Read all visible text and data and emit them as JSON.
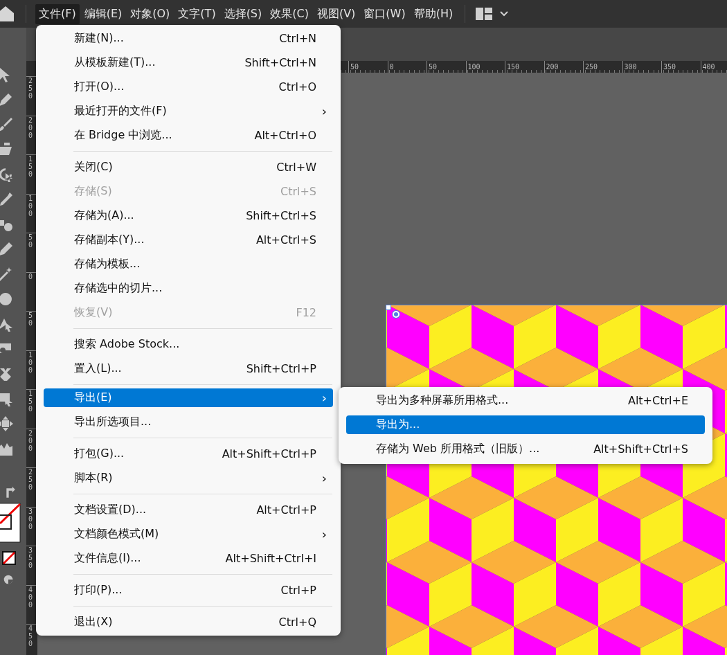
{
  "menu_bar": {
    "items": [
      {
        "label": "文件(F)",
        "selected": true
      },
      {
        "label": "编辑(E)",
        "selected": false
      },
      {
        "label": "对象(O)",
        "selected": false
      },
      {
        "label": "文字(T)",
        "selected": false
      },
      {
        "label": "选择(S)",
        "selected": false
      },
      {
        "label": "效果(C)",
        "selected": false
      },
      {
        "label": "视图(V)",
        "selected": false
      },
      {
        "label": "窗口(W)",
        "selected": false
      },
      {
        "label": "帮助(H)",
        "selected": false
      }
    ]
  },
  "rulers": {
    "horizontal": [
      "50",
      "0",
      "50",
      "100",
      "150",
      "200",
      "250",
      "300",
      "350",
      "400"
    ],
    "vertical": [
      "250",
      "200",
      "150",
      "100",
      "50",
      "0",
      "50",
      "100",
      "150",
      "200",
      "250",
      "300",
      "350",
      "400",
      "450"
    ]
  },
  "file_menu": {
    "items": [
      {
        "kind": "item",
        "label": "新建(N)...",
        "shortcut": "Ctrl+N",
        "disabled": false,
        "selected": false
      },
      {
        "kind": "item",
        "label": "从模板新建(T)...",
        "shortcut": "Shift+Ctrl+N",
        "disabled": false,
        "selected": false
      },
      {
        "kind": "item",
        "label": "打开(O)...",
        "shortcut": "Ctrl+O",
        "disabled": false,
        "selected": false
      },
      {
        "kind": "item",
        "label": "最近打开的文件(F)",
        "submenu_arrow": "›",
        "disabled": false,
        "selected": false
      },
      {
        "kind": "item",
        "label": "在 Bridge 中浏览...",
        "shortcut": "Alt+Ctrl+O",
        "disabled": false,
        "selected": false
      },
      {
        "kind": "separator"
      },
      {
        "kind": "item",
        "label": "关闭(C)",
        "shortcut": "Ctrl+W",
        "disabled": false,
        "selected": false
      },
      {
        "kind": "item",
        "label": "存储(S)",
        "shortcut": "Ctrl+S",
        "disabled": true,
        "selected": false
      },
      {
        "kind": "item",
        "label": "存储为(A)...",
        "shortcut": "Shift+Ctrl+S",
        "disabled": false,
        "selected": false
      },
      {
        "kind": "item",
        "label": "存储副本(Y)...",
        "shortcut": "Alt+Ctrl+S",
        "disabled": false,
        "selected": false
      },
      {
        "kind": "item",
        "label": "存储为模板...",
        "disabled": false,
        "selected": false
      },
      {
        "kind": "item",
        "label": "存储选中的切片...",
        "disabled": false,
        "selected": false
      },
      {
        "kind": "item",
        "label": "恢复(V)",
        "shortcut": "F12",
        "disabled": true,
        "selected": false
      },
      {
        "kind": "separator"
      },
      {
        "kind": "item",
        "label": "搜索 Adobe Stock...",
        "disabled": false,
        "selected": false
      },
      {
        "kind": "item",
        "label": "置入(L)...",
        "shortcut": "Shift+Ctrl+P",
        "disabled": false,
        "selected": false
      },
      {
        "kind": "separator"
      },
      {
        "kind": "item",
        "label": "导出(E)",
        "submenu_arrow": "›",
        "disabled": false,
        "selected": true
      },
      {
        "kind": "item",
        "label": "导出所选项目...",
        "disabled": false,
        "selected": false
      },
      {
        "kind": "separator"
      },
      {
        "kind": "item",
        "label": "打包(G)...",
        "shortcut": "Alt+Shift+Ctrl+P",
        "disabled": false,
        "selected": false
      },
      {
        "kind": "item",
        "label": "脚本(R)",
        "submenu_arrow": "›",
        "disabled": false,
        "selected": false
      },
      {
        "kind": "separator"
      },
      {
        "kind": "item",
        "label": "文档设置(D)...",
        "shortcut": "Alt+Ctrl+P",
        "disabled": false,
        "selected": false
      },
      {
        "kind": "item",
        "label": "文档颜色模式(M)",
        "submenu_arrow": "›",
        "disabled": false,
        "selected": false
      },
      {
        "kind": "item",
        "label": "文件信息(I)...",
        "shortcut": "Alt+Shift+Ctrl+I",
        "disabled": false,
        "selected": false
      },
      {
        "kind": "separator"
      },
      {
        "kind": "item",
        "label": "打印(P)...",
        "shortcut": "Ctrl+P",
        "disabled": false,
        "selected": false
      },
      {
        "kind": "separator"
      },
      {
        "kind": "item",
        "label": "退出(X)",
        "shortcut": "Ctrl+Q",
        "disabled": false,
        "selected": false
      }
    ]
  },
  "export_submenu": {
    "items": [
      {
        "label": "导出为多种屏幕所用格式...",
        "shortcut": "Alt+Ctrl+E",
        "selected": false
      },
      {
        "label": "导出为...",
        "selected": true
      },
      {
        "label": "存储为 Web 所用格式（旧版）...",
        "shortcut": "Alt+Shift+Ctrl+S",
        "selected": false
      }
    ]
  }
}
